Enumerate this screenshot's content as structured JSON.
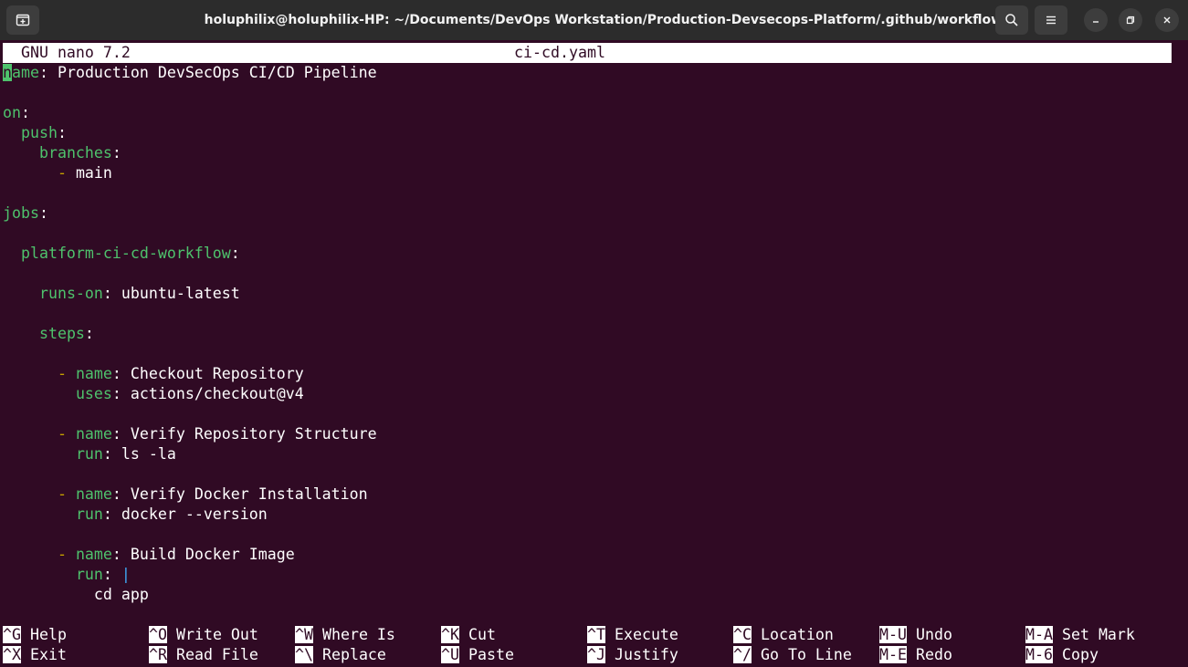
{
  "titlebar": {
    "title": "holuphilix@holuphilix-HP: ~/Documents/DevOps Workstation/Production-Devsecops-Platform/.github/workflows"
  },
  "editor": {
    "app": "GNU nano 7.2",
    "filename": "ci-cd.yaml",
    "lines": [
      {
        "indent": "",
        "key": "name",
        "sep": ": ",
        "value": "Production DevSecOps CI/CD Pipeline"
      },
      {
        "indent": "",
        "key": "on",
        "sep": ":",
        "value": ""
      },
      {
        "indent": "  ",
        "key": "push",
        "sep": ":",
        "value": ""
      },
      {
        "indent": "    ",
        "key": "branches",
        "sep": ":",
        "value": ""
      },
      {
        "indent": "      ",
        "dash": "- ",
        "value": "main"
      },
      {
        "indent": "",
        "key": "jobs",
        "sep": ":",
        "value": ""
      },
      {
        "indent": "  ",
        "key": "platform-ci-cd-workflow",
        "sep": ":",
        "value": ""
      },
      {
        "indent": "    ",
        "key": "runs-on",
        "sep": ": ",
        "value": "ubuntu-latest"
      },
      {
        "indent": "    ",
        "key": "steps",
        "sep": ":",
        "value": ""
      },
      {
        "indent": "      ",
        "dash": "- ",
        "key": "name",
        "sep": ": ",
        "value": "Checkout Repository"
      },
      {
        "indent": "        ",
        "key": "uses",
        "sep": ": ",
        "value": "actions/checkout@v4"
      },
      {
        "indent": "      ",
        "dash": "- ",
        "key": "name",
        "sep": ": ",
        "value": "Verify Repository Structure"
      },
      {
        "indent": "        ",
        "key": "run",
        "sep": ": ",
        "value": "ls -la"
      },
      {
        "indent": "      ",
        "dash": "- ",
        "key": "name",
        "sep": ": ",
        "value": "Verify Docker Installation"
      },
      {
        "indent": "        ",
        "key": "run",
        "sep": ": ",
        "value": "docker --version"
      },
      {
        "indent": "      ",
        "dash": "- ",
        "key": "name",
        "sep": ": ",
        "value": "Build Docker Image"
      },
      {
        "indent": "        ",
        "key": "run",
        "sep": ": ",
        "pipe": "|"
      },
      {
        "indent": "          ",
        "value": "cd app"
      }
    ]
  },
  "shortcuts": [
    {
      "key": "^G",
      "label": "Help"
    },
    {
      "key": "^X",
      "label": "Exit"
    },
    {
      "key": "^O",
      "label": "Write Out"
    },
    {
      "key": "^R",
      "label": "Read File"
    },
    {
      "key": "^W",
      "label": "Where Is"
    },
    {
      "key": "^\\",
      "label": "Replace"
    },
    {
      "key": "^K",
      "label": "Cut"
    },
    {
      "key": "^U",
      "label": "Paste"
    },
    {
      "key": "^T",
      "label": "Execute"
    },
    {
      "key": "^J",
      "label": "Justify"
    },
    {
      "key": "^C",
      "label": "Location"
    },
    {
      "key": "^/",
      "label": "Go To Line"
    },
    {
      "key": "M-U",
      "label": "Undo"
    },
    {
      "key": "M-E",
      "label": "Redo"
    },
    {
      "key": "M-A",
      "label": "Set Mark"
    },
    {
      "key": "M-6",
      "label": "Copy"
    }
  ],
  "colors": {
    "terminal_bg": "#300a24",
    "titlebar_bg": "#2c2c2c",
    "yaml_key": "#4ec26c",
    "list_dash": "#c4a000",
    "block_pipe": "#3fa9f5"
  },
  "icons": {
    "new_tab": "new-tab-icon",
    "search": "search-icon",
    "menu": "hamburger-menu-icon",
    "minimize": "minimize-icon",
    "maximize": "maximize-icon",
    "close": "close-icon"
  }
}
